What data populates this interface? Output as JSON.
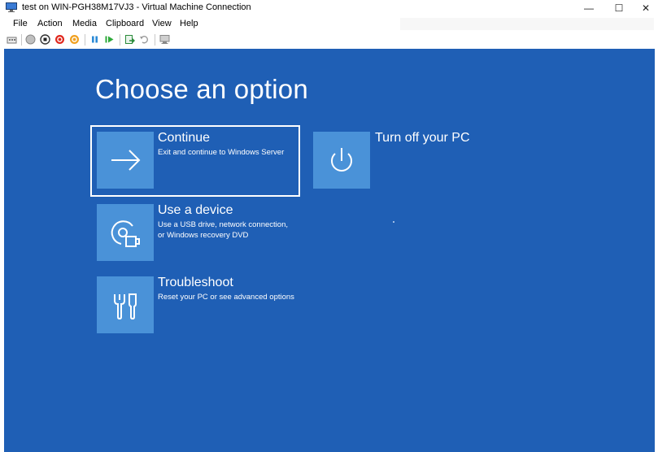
{
  "window": {
    "title": "test on WIN-PGH38M17VJ3 - Virtual Machine Connection",
    "controls": {
      "minimize": "—",
      "maximize": "☐",
      "close": "✕"
    }
  },
  "menu": {
    "items": [
      "File",
      "Action",
      "Media",
      "Clipboard",
      "View",
      "Help"
    ]
  },
  "toolbar": {
    "buttons": [
      "ctrl-alt-del-icon",
      "start-icon",
      "turn-off-icon",
      "shut-down-icon",
      "save-icon",
      "pause-icon",
      "reset-icon",
      "checkpoint-icon",
      "revert-icon",
      "enhanced-session-icon"
    ]
  },
  "screen": {
    "heading": "Choose an option",
    "options": [
      {
        "title": "Continue",
        "desc": [
          "Exit and continue to Windows Server"
        ],
        "icon": "arrow-right-icon"
      },
      {
        "title": "Use a device",
        "desc": [
          "Use a USB drive, network connection,",
          "or Windows recovery DVD"
        ],
        "icon": "device-icon"
      },
      {
        "title": "Troubleshoot",
        "desc": [
          "Reset your PC or see advanced options"
        ],
        "icon": "tools-icon"
      },
      {
        "title": "Turn off your PC",
        "desc": [],
        "icon": "power-icon"
      }
    ]
  },
  "colors": {
    "screen_bg": "#1f5fb5",
    "tile_bg": "#4a92d8",
    "text": "#ffffff"
  }
}
